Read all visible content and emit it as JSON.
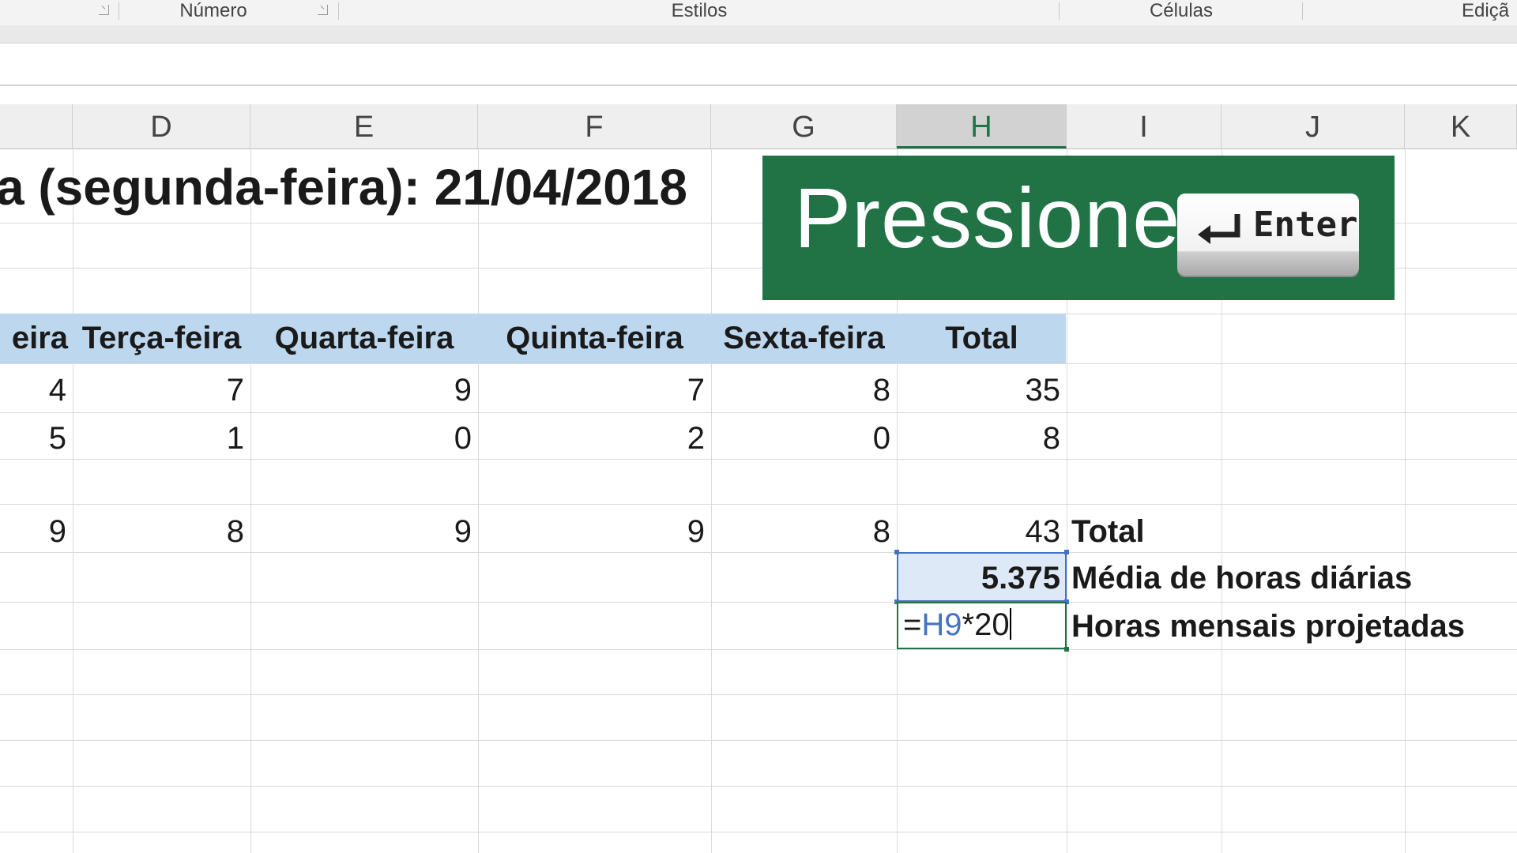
{
  "ribbon": {
    "groups": [
      "Número",
      "Estilos",
      "Células",
      "Ediçã"
    ]
  },
  "columns": [
    "D",
    "E",
    "F",
    "G",
    "H",
    "I",
    "J",
    "K"
  ],
  "active_column": "H",
  "sheet": {
    "title": "a (segunda-feira): 21/04/2018",
    "headers": [
      "eira",
      "Terça-feira",
      "Quarta-feira",
      "Quinta-feira",
      "Sexta-feira",
      "Total"
    ],
    "rows": [
      [
        "4",
        "7",
        "9",
        "7",
        "8",
        "35"
      ],
      [
        "5",
        "1",
        "0",
        "2",
        "0",
        "8"
      ],
      [
        "9",
        "8",
        "9",
        "9",
        "8",
        "43"
      ]
    ],
    "total_label": "Total",
    "average_value": "5.375",
    "average_label": "Média de horas diárias",
    "formula_prefix": "=",
    "formula_ref": "H9",
    "formula_suffix": "*20",
    "projection_label": "Horas mensais projetadas"
  },
  "overlay": {
    "text": "Pressione",
    "key_label": "Enter",
    "icon": "enter-return-icon",
    "bg_color": "#217346"
  },
  "colors": {
    "excel_green": "#217346",
    "header_band": "#bdd7ee",
    "reference_blue": "#4472c4"
  }
}
